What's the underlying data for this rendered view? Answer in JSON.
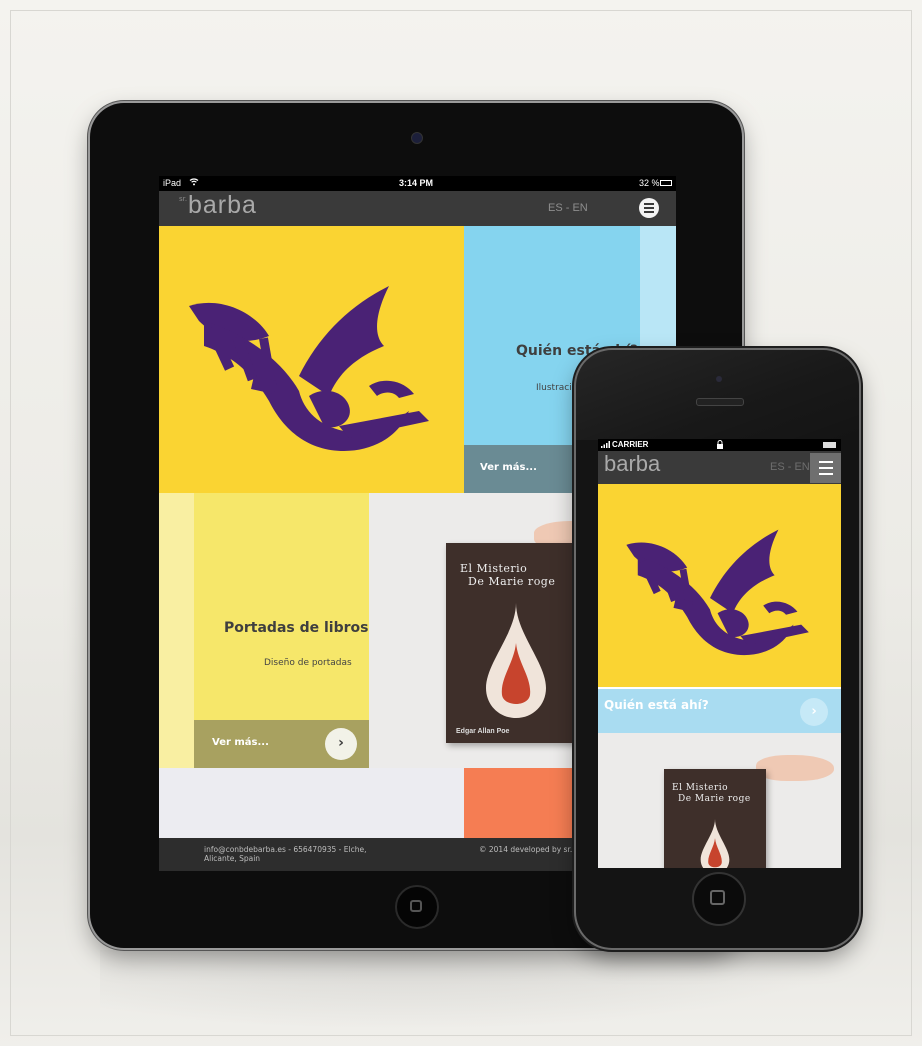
{
  "ipad": {
    "status_bar": {
      "device": "iPad",
      "time": "3:14 PM",
      "battery": "32 %"
    },
    "nav": {
      "logo_sup": "sr.",
      "logo": "barba",
      "lang": "ES - EN",
      "menu_icon": "hamburger-icon"
    },
    "tiles": {
      "quien": {
        "title": "Quién está ahí?",
        "subtitle": "Ilustración",
        "more": "Ver más..."
      },
      "portadas": {
        "title": "Portadas de libros",
        "subtitle": "Diseño de portadas",
        "more": "Ver más...",
        "arrow": "›"
      }
    },
    "book": {
      "title_line1": "El Misterio",
      "title_line2": "De Marie roge",
      "author": "Edgar Allan Poe"
    },
    "footer": {
      "contact_line1": "info@conbdebarba.es - 656470935 - Elche,",
      "contact_line2": "Alicante, Spain",
      "copyright": "© 2014 developed by sr.bar"
    }
  },
  "iphone": {
    "status_bar": {
      "carrier": "CARRIER"
    },
    "nav": {
      "logo": "barba",
      "lang": "ES - EN"
    },
    "tiles": {
      "quien": {
        "title": "Quién está ahí?",
        "arrow": "›"
      }
    },
    "book": {
      "title_line1": "El Misterio",
      "title_line2": "De Marie roge"
    }
  },
  "colors": {
    "yellow": "#fad432",
    "light_yellow": "#f6e76a",
    "sky_blue": "#85d4ef",
    "purple": "#4a2275",
    "nav_gray": "#3a3a3a",
    "coral": "#f57d53"
  }
}
